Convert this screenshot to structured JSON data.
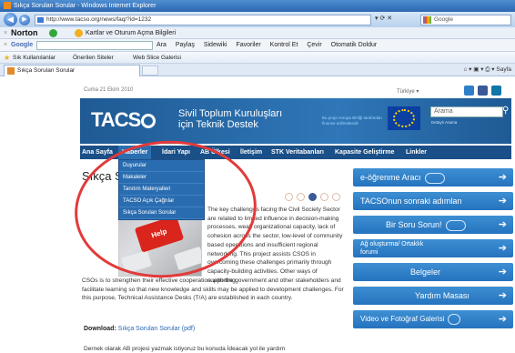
{
  "window": {
    "title": "Sıkça Sorulan Sorular - Windows Internet Explorer"
  },
  "address": {
    "url": "http://www.tacso.org/news/faq/?id=1232",
    "search_engine": "Google"
  },
  "norton": {
    "logo": "Norton",
    "text": "Kartlar ve Oturum Açma Bilgileri"
  },
  "google_toolbar": {
    "logo": "Google",
    "tools": [
      "Ara",
      "Paylaş",
      "Sidewiki",
      "Favoriler",
      "Kontrol Et",
      "Çevir",
      "Otomatik Doldur"
    ]
  },
  "favorites": {
    "label": "Sık Kullanılanlar",
    "items": [
      "Önerilen Siteler",
      "Web Slice Galerisi"
    ]
  },
  "tab": {
    "label": "Sıkça Sorulan Sorular"
  },
  "commandbar": {
    "text": "Sayfa"
  },
  "page": {
    "date": "Cuma 21 Ekim 2010",
    "language": "Türkiye",
    "banner": {
      "logo": "TACS",
      "title_line1": "Sivil Toplum Kuruluşları",
      "title_line2": "için Teknik Destek",
      "tagline": "Bu proje Avrupa Birliği tarafından finanse edilmektedir",
      "search_placeholder": "Arama",
      "advanced_search": "Detaylı Arama"
    },
    "nav": [
      "Ana Sayfa",
      "Haberler",
      "İdari Yapı",
      "AB Ülkesi",
      "İletişim",
      "STK Veritabanları",
      "Kapasite Geliştirme",
      "Linkler"
    ],
    "dropdown": [
      "Duyurular",
      "Makaleler",
      "Tanıtım Materyalleri",
      "TACSO Açık Çağrılar",
      "Sıkça Sorulan Sorular"
    ],
    "heading": "Sıkça S",
    "image_key_text": "Help",
    "body_narrow": "The key challenges facing the Civil Society Sector are related to limited influence in decision-making processes, weak organizational capacity, lack of cohesion across the sector, low-level of community based operations and insufficient regional networking. This project assists CSOS in overcoming these challenges primarily through capacity-building activities. Other ways of supporting",
    "body_wide": "CSOs is to strengthen their effective cooperation with the government and other stakeholders and facilitate learning so that new knowledge and skills may be applied to development  challenges. For this purpose, Technical Assistance Desks (T/A) are established in each country.",
    "download_label": "Download:",
    "download_link": "Sıkça Sorulan Sorular (pdf)",
    "cut_text": "Dernek olarak AB projesi yazmak istiyoruz bu konuda İdeacak yol ile yardım"
  },
  "sidebar": [
    "e-öğrenme Aracı",
    "TACSOnun sonraki adımları",
    "Bir Soru Sorun!",
    "Ağ oluşturma/ Ortaklık forumi",
    "Belgeler",
    "Yardım Masası",
    "Video ve Fotoğraf Galerisi"
  ],
  "colors": {
    "accent": "#2573bf",
    "nav": "#1a4f87",
    "highlight_oval": "#e23a3a"
  }
}
